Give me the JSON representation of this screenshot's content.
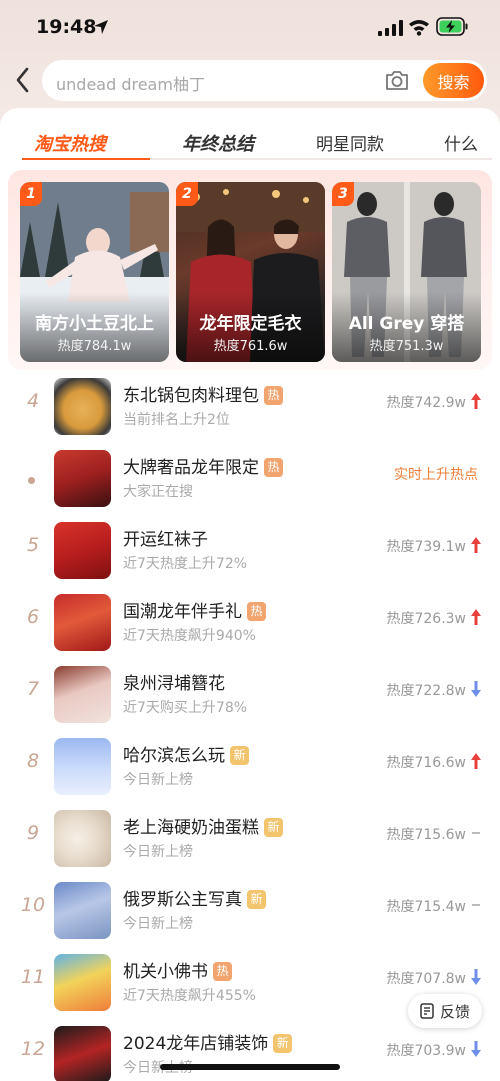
{
  "status_bar": {
    "time": "19:48"
  },
  "search": {
    "placeholder": "undead dream柚丁",
    "button": "搜索"
  },
  "tabs": [
    {
      "label": "淘宝热搜"
    },
    {
      "label": "年终总结"
    },
    {
      "label": "明星同款"
    },
    {
      "label": "什么"
    }
  ],
  "hero": [
    {
      "rank": "1",
      "title": "南方小土豆北上",
      "heat": "热度784.1w"
    },
    {
      "rank": "2",
      "title": "龙年限定毛衣",
      "heat": "热度761.6w"
    },
    {
      "rank": "3",
      "title": "All Grey 穿搭",
      "heat": "热度751.3w"
    }
  ],
  "list": [
    {
      "rank": "4",
      "title": "东北锅包肉料理包",
      "tag": "热",
      "sub": "当前排名上升2位",
      "heat": "热度742.9w",
      "trend": "up"
    },
    {
      "rank": "",
      "title": "大牌奢品龙年限定",
      "tag": "热",
      "sub": "大家正在搜",
      "heat": "实时上升热点",
      "trend": "none"
    },
    {
      "rank": "5",
      "title": "开运红袜子",
      "tag": "",
      "sub": "近7天热度上升72%",
      "heat": "热度739.1w",
      "trend": "up"
    },
    {
      "rank": "6",
      "title": "国潮龙年伴手礼",
      "tag": "热",
      "sub": "近7天热度飙升940%",
      "heat": "热度726.3w",
      "trend": "up"
    },
    {
      "rank": "7",
      "title": "泉州浔埔簪花",
      "tag": "",
      "sub": "近7天购买上升78%",
      "heat": "热度722.8w",
      "trend": "down"
    },
    {
      "rank": "8",
      "title": "哈尔滨怎么玩",
      "tag": "新",
      "sub": "今日新上榜",
      "heat": "热度716.6w",
      "trend": "up"
    },
    {
      "rank": "9",
      "title": "老上海硬奶油蛋糕",
      "tag": "新",
      "sub": "今日新上榜",
      "heat": "热度715.6w",
      "trend": "flat"
    },
    {
      "rank": "10",
      "title": "俄罗斯公主写真",
      "tag": "新",
      "sub": "今日新上榜",
      "heat": "热度715.4w",
      "trend": "flat"
    },
    {
      "rank": "11",
      "title": "机关小佛书",
      "tag": "热",
      "sub": "近7天热度飙升455%",
      "heat": "热度707.8w",
      "trend": "down"
    },
    {
      "rank": "12",
      "title": "2024龙年店铺装饰",
      "tag": "新",
      "sub": "今日新上榜",
      "heat": "热度703.9w",
      "trend": "down"
    }
  ],
  "feedback": {
    "label": "反馈"
  },
  "colors": {
    "accent": "#ff5a17",
    "up": "#e8403a",
    "down": "#6f8ee8",
    "rank": "#c9a694"
  }
}
